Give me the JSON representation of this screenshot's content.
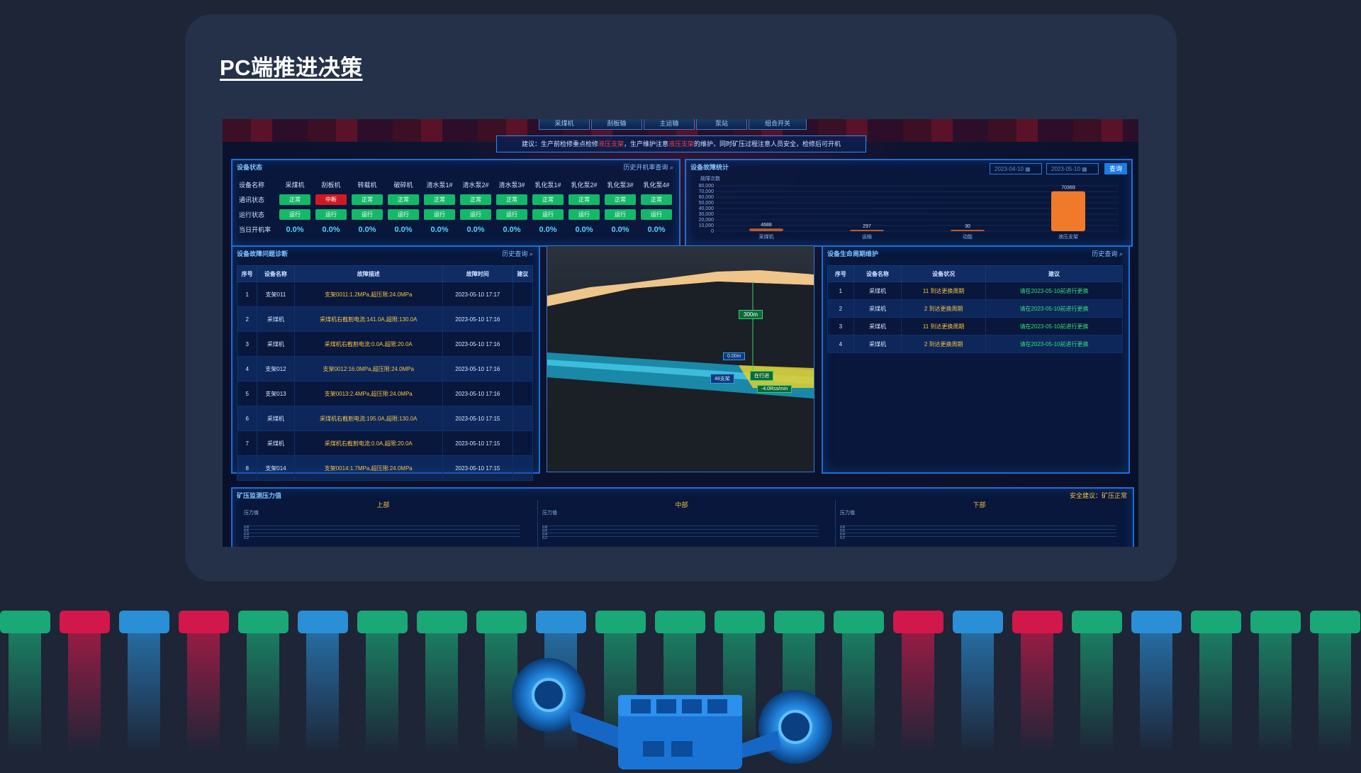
{
  "page_title": "PC端推进决策",
  "screen": {
    "nav_items": [
      "采煤机",
      "刮板输",
      "主运输",
      "泵站",
      "组合开关"
    ],
    "advice": {
      "prefix": "建议：生产前检修重点检修",
      "hl1": "液压支架",
      "mid": "，生产维护注意",
      "hl2": "液压支架",
      "suffix": "的维护，同时矿压过程注意人员安全，检修后可开机"
    },
    "device_status": {
      "title": "设备状态",
      "link": "历史开机率查询",
      "row_labels": [
        "设备名称",
        "通讯状态",
        "运行状态",
        "当日开机率"
      ],
      "devices": [
        "采煤机",
        "刮板机",
        "转载机",
        "破碎机",
        "清水泵1#",
        "清水泵2#",
        "清水泵3#",
        "乳化泵1#",
        "乳化泵2#",
        "乳化泵3#",
        "乳化泵4#"
      ],
      "comm": [
        "正常",
        "中断",
        "正常",
        "正常",
        "正常",
        "正常",
        "正常",
        "正常",
        "正常",
        "正常",
        "正常"
      ],
      "run": [
        "运行",
        "运行",
        "运行",
        "运行",
        "运行",
        "运行",
        "运行",
        "运行",
        "运行",
        "运行",
        "运行"
      ],
      "rate": [
        "0.0%",
        "0.0%",
        "0.0%",
        "0.0%",
        "0.0%",
        "0.0%",
        "0.0%",
        "0.0%",
        "0.0%",
        "0.0%",
        "0.0%"
      ]
    },
    "fault_stats": {
      "title": "设备故障统计",
      "date_from": "2023-04-10",
      "date_to": "2023-05-10",
      "query": "查询",
      "y_label": "故障次数",
      "y_ticks": [
        "80,000",
        "70,000",
        "60,000",
        "50,000",
        "40,000",
        "30,000",
        "20,000",
        "10,000",
        "0"
      ],
      "categories": [
        "采煤机",
        "运输",
        "动能",
        "液压支架"
      ],
      "values": [
        4688,
        297,
        30,
        70369
      ]
    },
    "fault_table": {
      "title": "设备故障问题诊断",
      "link": "历史查询",
      "headers": [
        "序号",
        "设备名称",
        "故障描述",
        "故障时间",
        "建议"
      ],
      "rows": [
        [
          "1",
          "支架011",
          "支架0011:1.2MPa,超压限:24.0MPa",
          "2023-05-10 17:17",
          ""
        ],
        [
          "2",
          "采煤机",
          "采煤机右截割电流:141.0A,超限:130.0A",
          "2023-05-10 17:16",
          ""
        ],
        [
          "3",
          "采煤机",
          "采煤机右截割电流:0.0A,超限:20.0A",
          "2023-05-10 17:16",
          ""
        ],
        [
          "4",
          "支架012",
          "支架0012:16.0MPa,超压限:24.0MPa",
          "2023-05-10 17:16",
          ""
        ],
        [
          "5",
          "支架013",
          "支架0013:2.4MPa,超压限:24.0MPa",
          "2023-05-10 17:16",
          ""
        ],
        [
          "6",
          "采煤机",
          "采煤机右截割电流:195.0A,超限:130.0A",
          "2023-05-10 17:15",
          ""
        ],
        [
          "7",
          "采煤机",
          "采煤机右截割电流:0.0A,超限:20.0A",
          "2023-05-10 17:15",
          ""
        ],
        [
          "8",
          "支架014",
          "支架0014:1.7MPa,超压限:24.0MPa",
          "2023-05-10 17:15",
          ""
        ]
      ]
    },
    "view3d": {
      "tag1": "300m",
      "tag2": "0.00m",
      "tag3": "48支架",
      "tag4": "在行进",
      "tag5": "-4.0Rss/min"
    },
    "lifecycle": {
      "title": "设备生命周期维护",
      "link": "历史查询",
      "headers": [
        "序号",
        "设备名称",
        "设备状况",
        "建议"
      ],
      "rows": [
        [
          "1",
          "采煤机",
          "11 到达更换周期",
          "请在2023-05-10前进行更换"
        ],
        [
          "2",
          "采煤机",
          "2 到达更换周期",
          "请在2023-05-10前进行更换"
        ],
        [
          "3",
          "采煤机",
          "11 到达更换周期",
          "请在2023-05-10前进行更换"
        ],
        [
          "4",
          "采煤机",
          "2 到达更换周期",
          "请在2023-05-10前进行更换"
        ]
      ]
    },
    "pressure": {
      "title": "矿压监测压力值",
      "note": "安全建议：矿压正常",
      "sections": [
        "上部",
        "中部",
        "下部"
      ],
      "y_label": "压力值",
      "ticks": [
        "0.8",
        "0.6",
        "0.4",
        "0.2"
      ]
    }
  },
  "stripe_colors": [
    "#1aa876",
    "#d2184a",
    "#2a8fd6",
    "#d2184a",
    "#1aa876",
    "#2a8fd6",
    "#1aa876",
    "#1aa876",
    "#1aa876",
    "#2a8fd6",
    "#1aa876",
    "#1aa876",
    "#1aa876",
    "#1aa876",
    "#1aa876",
    "#d2184a",
    "#2a8fd6",
    "#d2184a",
    "#1aa876",
    "#2a8fd6",
    "#1aa876",
    "#1aa876",
    "#1aa876"
  ]
}
